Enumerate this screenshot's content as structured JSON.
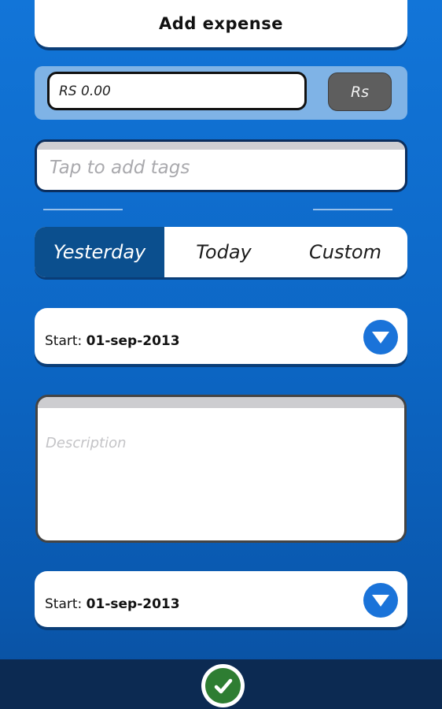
{
  "header": {
    "title": "Add expense"
  },
  "amount": {
    "value": "RS 0.00",
    "currency_label": "Rs"
  },
  "tags": {
    "placeholder": "Tap to add tags"
  },
  "day_selector": {
    "options": [
      "Yesterday",
      "Today",
      "Custom"
    ],
    "selected": "Yesterday"
  },
  "start_date_1": {
    "label": "Start:",
    "value": "01-sep-2013"
  },
  "description": {
    "placeholder": "Description"
  },
  "start_date_2": {
    "label": "Start:",
    "value": "01-sep-2013"
  },
  "icons": {
    "dropdown": "chevron-down-icon",
    "confirm": "checkmark-icon"
  },
  "colors": {
    "background": "#1275d8",
    "selected_segment": "#0b4f8e",
    "dropdown_button": "#1a73d9",
    "bottom_bar": "#0c2a52",
    "confirm": "#2e7d32"
  }
}
